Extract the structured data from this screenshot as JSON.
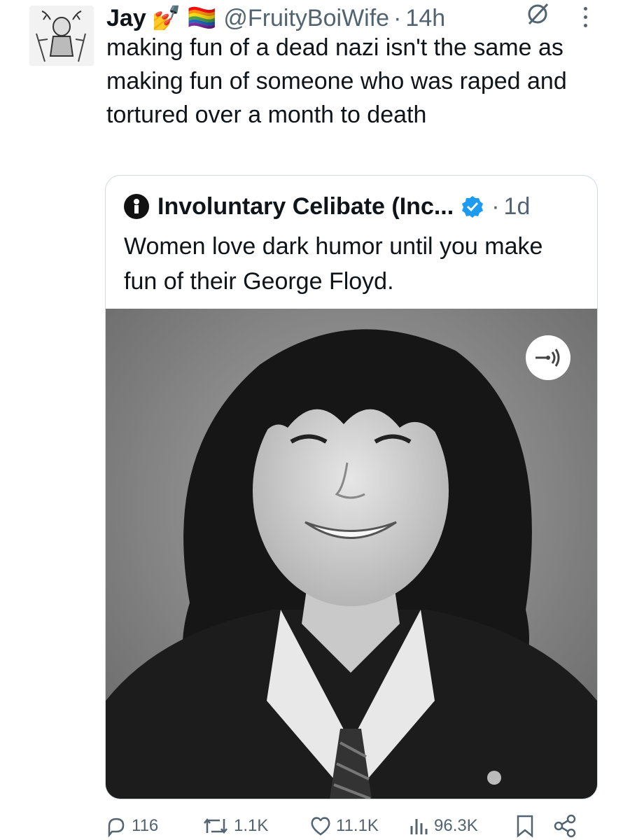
{
  "tweet": {
    "author_name": "Jay",
    "author_emoji": "💅",
    "flag_emoji": "🏳️‍🌈",
    "handle": "@FruityBoiWife",
    "separator": "·",
    "time": "14h",
    "text": "making fun of a dead nazi isn't the same as making fun of someone who was raped and tortured over a month to death"
  },
  "quoted": {
    "author_name": "Involuntary Celibate (Inc...",
    "separator": "·",
    "time": "1d",
    "text": "Women love dark humor until you make fun of their George Floyd."
  },
  "actions": {
    "replies": "116",
    "reposts": "1.1K",
    "likes": "11.1K",
    "views": "96.3K"
  },
  "colors": {
    "text": "#0f1419",
    "secondary": "#536471",
    "border": "#cfd9de",
    "verified": "#1d9bf0"
  },
  "icons": [
    "grok-icon",
    "more-icon",
    "verified-icon",
    "audio-icon",
    "reply-icon",
    "repost-icon",
    "like-icon",
    "views-icon",
    "bookmark-icon",
    "share-icon"
  ]
}
